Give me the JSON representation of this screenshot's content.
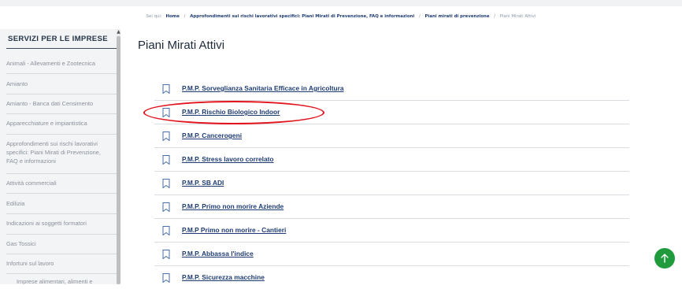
{
  "breadcrumb": {
    "lead": "Sei qui:",
    "items": [
      {
        "label": "Home"
      },
      {
        "label": "Approfondimenti sui rischi lavorativi specifici: Piani Mirati di Prevenzione, FAQ e informazioni"
      },
      {
        "label": "Piani mirati di prevenzione"
      },
      {
        "label": "Piani Mirati Attivi"
      }
    ]
  },
  "sidebar": {
    "title": "SERVIZI PER LE IMPRESE",
    "items": [
      {
        "label": "Animali - Allevamenti e Zootecnica"
      },
      {
        "label": "Amianto"
      },
      {
        "label": "Amianto - Banca dati Censimento"
      },
      {
        "label": "Apparecchiature e impiantistica"
      },
      {
        "label": "Approfondimenti sui rischi lavorativi specifici: Piani Mirati di Prevenzione, FAQ e informazioni"
      },
      {
        "label": "Attività commerciali"
      },
      {
        "label": "Edilizia"
      },
      {
        "label": "Indicazioni ai soggetti formatori"
      },
      {
        "label": "Gas Tossici"
      },
      {
        "label": "Infortuni sul lavoro"
      },
      {
        "label": "Imprese alimentari, alimenti e"
      }
    ]
  },
  "main": {
    "title": "Piani Mirati Attivi",
    "plans": [
      {
        "label": "P.M.P. Sorveglianza Sanitaria Efficace in Agricoltura"
      },
      {
        "label": "P.M.P. Rischio Biologico Indoor"
      },
      {
        "label": "P.M.P. Cancerogeni"
      },
      {
        "label": "P.M.P. Stress lavoro correlato"
      },
      {
        "label": "P.M.P. SB ADI"
      },
      {
        "label": "P.M.P. Primo non morire Aziende"
      },
      {
        "label": "P.M.P Primo non morire - Cantieri"
      },
      {
        "label": "P.M.P. Abbassa l'indice"
      },
      {
        "label": "P.M.P. Sicurezza macchine"
      }
    ]
  },
  "colors": {
    "link": "#1f3c73",
    "highlight": "#e2131d",
    "back_to_top": "#1f9b3d"
  },
  "icons": {
    "plan_icon": "bookmark-icon",
    "back_to_top": "arrow-up-icon"
  }
}
